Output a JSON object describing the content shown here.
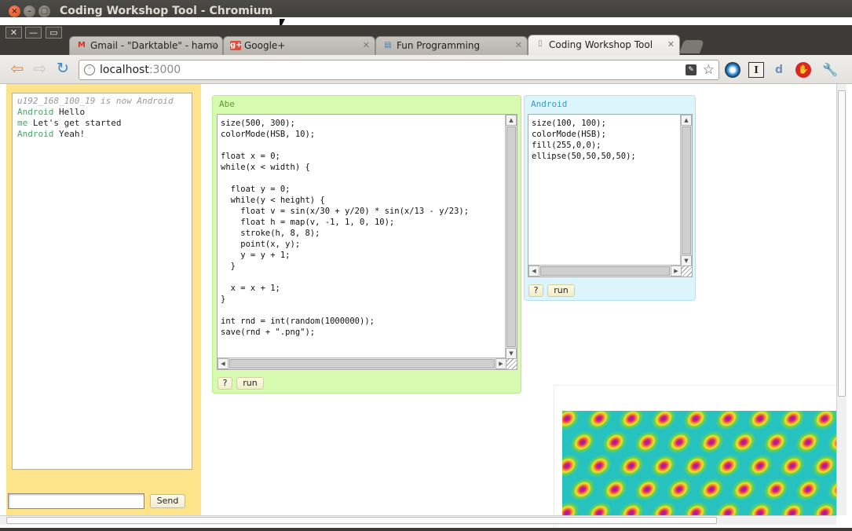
{
  "window": {
    "title": "Coding Workshop Tool - Chromium",
    "close_glyph": "×",
    "min_glyph": "–",
    "max_glyph": "□"
  },
  "system_buttons": [
    "✕",
    "—",
    "▭"
  ],
  "tabs": [
    {
      "label": "Gmail - \"Darktable\" - hamo",
      "favicon": "M",
      "favicon_color": "#d93025"
    },
    {
      "label": "Google+",
      "favicon": "g+",
      "favicon_color": "#dd4b39"
    },
    {
      "label": "Fun Programming",
      "favicon": "▤",
      "favicon_color": "#4a7fb5"
    },
    {
      "label": "Coding Workshop Tool",
      "favicon": "▯",
      "favicon_color": "#888888"
    }
  ],
  "tab_close_glyph": "✕",
  "toolbar": {
    "back_glyph": "⇦",
    "forward_glyph": "⇨",
    "reload_glyph": "↻",
    "url_host": "localhost",
    "url_port": ":3000",
    "extensions": [
      "circle-eye",
      "I",
      "d",
      "stop",
      "🔧"
    ]
  },
  "chat": {
    "messages": [
      {
        "type": "system",
        "text": "u192_168_100_19 is now Android"
      },
      {
        "type": "message",
        "author": "Android",
        "text": "Hello"
      },
      {
        "type": "message",
        "author": "me",
        "text": "Let's get started"
      },
      {
        "type": "message",
        "author": "Android",
        "text": "Yeah!"
      }
    ],
    "input_value": "",
    "send_label": "Send"
  },
  "editors": [
    {
      "name": "Abe",
      "code": "size(500, 300);\ncolorMode(HSB, 10);\n\nfloat x = 0;\nwhile(x < width) {\n\n  float y = 0;\n  while(y < height) {\n    float v = sin(x/30 + y/20) * sin(x/13 - y/23);\n    float h = map(v, -1, 1, 0, 10);\n    stroke(h, 8, 8);\n    point(x, y);\n    y = y + 1;\n  }\n\n  x = x + 1;\n}\n\nint rnd = int(random(1000000));\nsave(rnd + \".png\");",
      "help_label": "?",
      "run_label": "run",
      "accent": "#d6fbb0"
    },
    {
      "name": "Android",
      "code": "size(100, 100);\ncolorMode(HSB);\nfill(255,0,0);\nellipse(50,50,50,50);",
      "help_label": "?",
      "run_label": "run",
      "accent": "#dcf4fc"
    }
  ],
  "colors": {
    "chat_panel": "#fde48a",
    "chat_author": "#4aa46a"
  }
}
